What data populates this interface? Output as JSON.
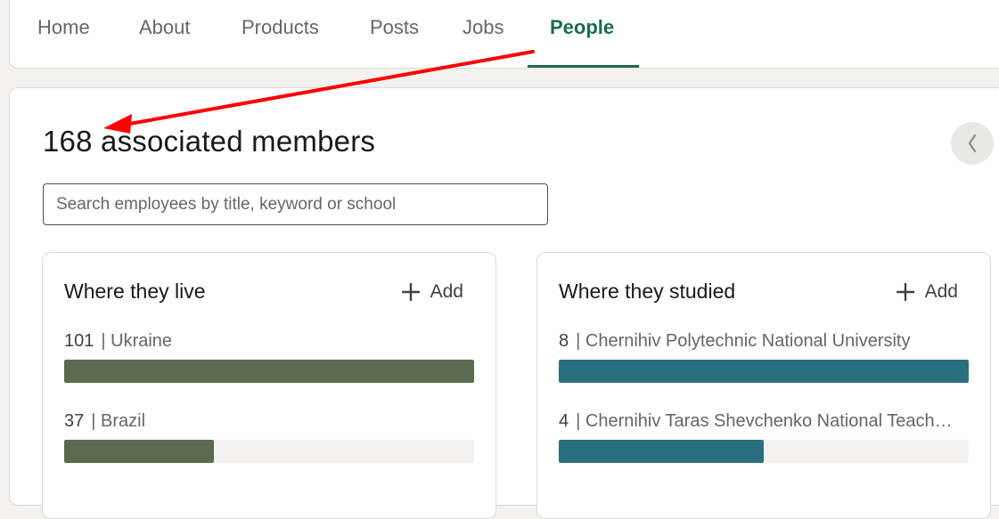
{
  "nav": {
    "tabs": [
      {
        "label": "Home"
      },
      {
        "label": "About"
      },
      {
        "label": "Products"
      },
      {
        "label": "Posts"
      },
      {
        "label": "Jobs"
      },
      {
        "label": "People"
      }
    ],
    "active_tab": "People",
    "accent_color": "#1d6b48"
  },
  "header": {
    "title": "168 associated members"
  },
  "search": {
    "placeholder": "Search employees by title, keyword or school"
  },
  "scroll_icon": "chevron-left-icon",
  "annotation": {
    "color": "#ff0000",
    "type": "arrow"
  },
  "cards": {
    "live": {
      "title": "Where they live",
      "add_label": "Add",
      "bar_color": "#5b6b4d",
      "rows": [
        {
          "count": "101",
          "label": "| Ukraine",
          "fraction": 1.0
        },
        {
          "count": "37",
          "label": "| Brazil",
          "fraction": 0.366
        }
      ]
    },
    "studied": {
      "title": "Where they studied",
      "add_label": "Add",
      "bar_color": "#2a6f80",
      "rows": [
        {
          "count": "8",
          "label": "| Chernihiv Polytechnic National University",
          "fraction": 1.0
        },
        {
          "count": "4",
          "label": "| Chernihiv Taras Shevchenko National Teach…",
          "fraction": 0.5
        }
      ]
    }
  }
}
